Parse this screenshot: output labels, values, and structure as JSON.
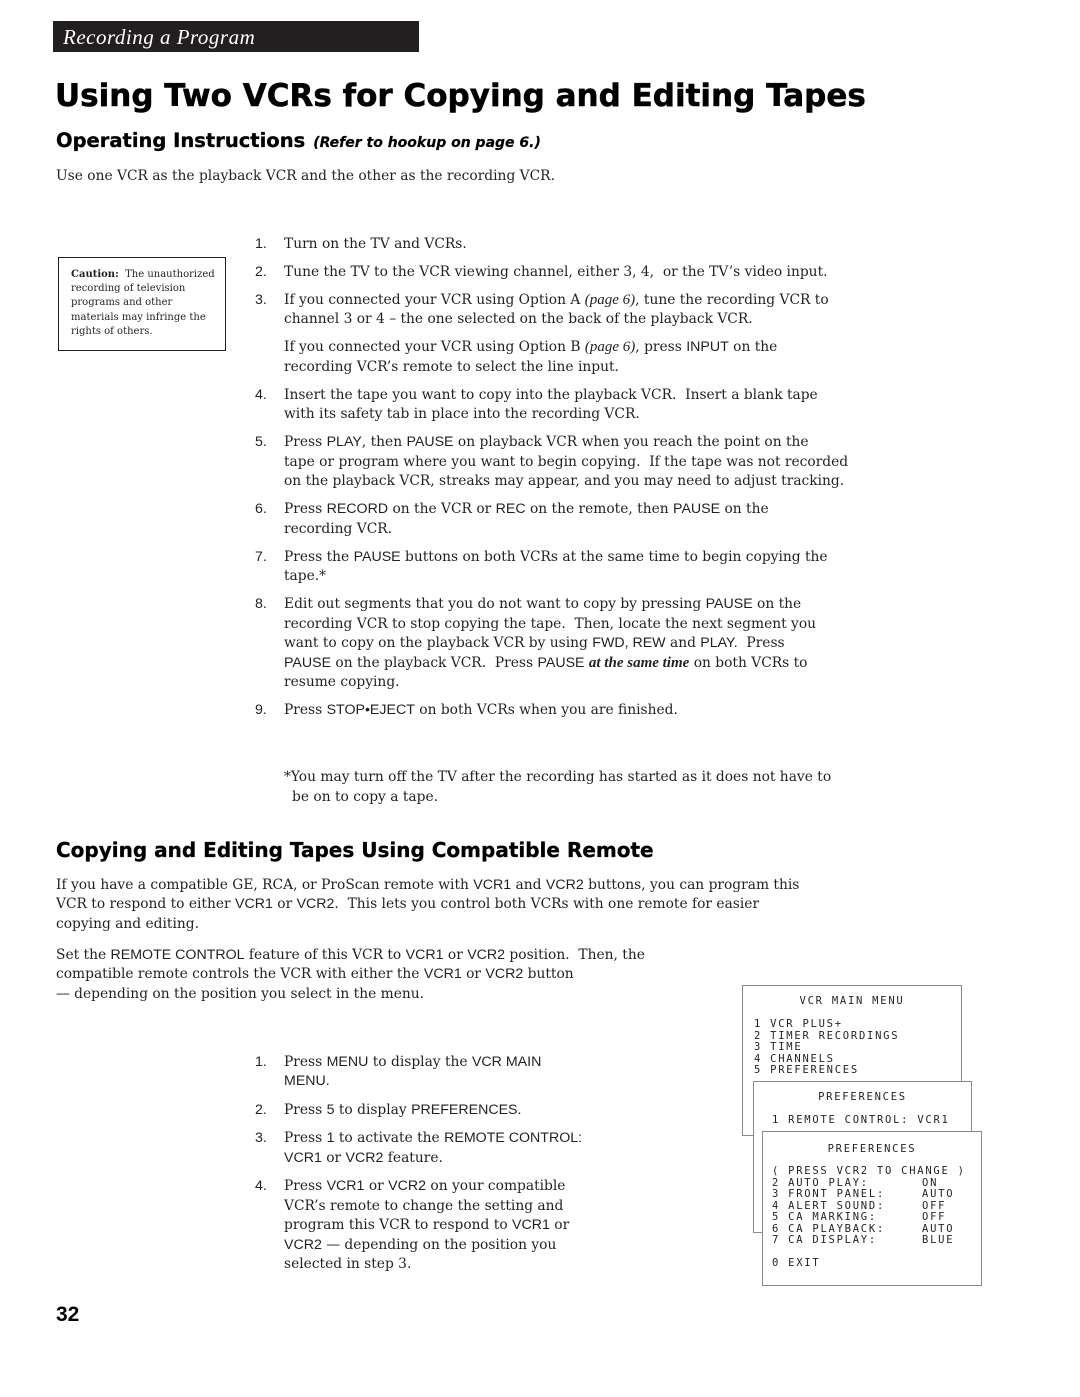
{
  "header": {
    "section_label": "Recording a Program"
  },
  "title": "Using Two VCRs for Copying and Editing Tapes",
  "section1": {
    "heading": "Operating Instructions",
    "heading_note": "(Refer to hookup on page 6.)",
    "intro": "Use one VCR as the playback VCR and the other as the recording VCR.",
    "caution": [
      {
        "type": "bold",
        "text": "Caution:"
      },
      {
        "type": "text",
        "text": "  The unauthorized\nrecording of television\nprograms and other\nmaterials may infringe the\nrights of others."
      }
    ],
    "steps": [
      {
        "num": "1.",
        "paras": [
          [
            {
              "type": "text",
              "text": "Turn on the TV and VCRs."
            }
          ]
        ]
      },
      {
        "num": "2.",
        "paras": [
          [
            {
              "type": "text",
              "text": "Tune the TV to the VCR viewing channel, either 3, 4,  or the TV’s video input."
            }
          ]
        ]
      },
      {
        "num": "3.",
        "paras": [
          [
            {
              "type": "text",
              "text": "If you connected your VCR using Option A "
            },
            {
              "type": "ref",
              "text": "(page 6)"
            },
            {
              "type": "text",
              "text": ", tune the recording VCR to\nchannel 3 or 4 – the one selected on the back of the playback VCR."
            }
          ],
          [
            {
              "type": "text",
              "text": "If you connected your VCR using Option B "
            },
            {
              "type": "ref",
              "text": "(page 6)"
            },
            {
              "type": "text",
              "text": ", press "
            },
            {
              "type": "key",
              "text": "INPUT"
            },
            {
              "type": "text",
              "text": " on the\nrecording VCR’s remote to select the line input."
            }
          ]
        ]
      },
      {
        "num": "4.",
        "paras": [
          [
            {
              "type": "text",
              "text": "Insert the tape you want to copy into the playback VCR.  Insert a blank tape\nwith its safety tab in place into the recording VCR."
            }
          ]
        ]
      },
      {
        "num": "5.",
        "paras": [
          [
            {
              "type": "text",
              "text": "Press "
            },
            {
              "type": "key",
              "text": "PLAY"
            },
            {
              "type": "text",
              "text": ", then "
            },
            {
              "type": "key",
              "text": "PAUSE"
            },
            {
              "type": "text",
              "text": " on playback VCR when you reach the point on the\ntape or program where you want to begin copying.  If the tape was not recorded\non the playback VCR, streaks may appear, and you may need to adjust tracking."
            }
          ]
        ]
      },
      {
        "num": "6.",
        "paras": [
          [
            {
              "type": "text",
              "text": "Press "
            },
            {
              "type": "key",
              "text": "RECORD"
            },
            {
              "type": "text",
              "text": " on the VCR or "
            },
            {
              "type": "key",
              "text": "REC"
            },
            {
              "type": "text",
              "text": " on the remote, then "
            },
            {
              "type": "key",
              "text": "PAUSE"
            },
            {
              "type": "text",
              "text": " on the\nrecording VCR."
            }
          ]
        ]
      },
      {
        "num": "7.",
        "paras": [
          [
            {
              "type": "text",
              "text": "Press the "
            },
            {
              "type": "key",
              "text": "PAUSE"
            },
            {
              "type": "text",
              "text": " buttons on both VCRs at the same time to begin copying the\ntape.*"
            }
          ]
        ]
      },
      {
        "num": "8.",
        "paras": [
          [
            {
              "type": "text",
              "text": "Edit out segments that you do not want to copy by pressing "
            },
            {
              "type": "key",
              "text": "PAUSE"
            },
            {
              "type": "text",
              "text": " on the\nrecording VCR to stop copying the tape.  Then, locate the next segment you\nwant to copy on the playback VCR by using "
            },
            {
              "type": "key",
              "text": "FWD, REW"
            },
            {
              "type": "text",
              "text": " and "
            },
            {
              "type": "key",
              "text": "PLAY."
            },
            {
              "type": "text",
              "text": "  Press\n"
            },
            {
              "type": "key",
              "text": "PAUSE"
            },
            {
              "type": "text",
              "text": " on the playback VCR.  Press "
            },
            {
              "type": "key",
              "text": "PAUSE"
            },
            {
              "type": "text",
              "text": " "
            },
            {
              "type": "em",
              "text": "at the same time"
            },
            {
              "type": "text",
              "text": " on both VCRs to\nresume copying."
            }
          ]
        ]
      },
      {
        "num": "9.",
        "paras": [
          [
            {
              "type": "text",
              "text": "Press "
            },
            {
              "type": "key",
              "text": "STOP•EJECT"
            },
            {
              "type": "text",
              "text": " on both VCRs when you are finished."
            }
          ]
        ]
      }
    ],
    "footnote": "*You may turn off the TV after the recording has started as it does not have to\nbe on to copy a tape."
  },
  "section2": {
    "heading": "Copying and Editing Tapes Using Compatible Remote",
    "paragraphs": [
      [
        {
          "type": "text",
          "text": "If you have a compatible GE, RCA, or ProScan remote with "
        },
        {
          "type": "key",
          "text": "VCR1"
        },
        {
          "type": "text",
          "text": " and "
        },
        {
          "type": "key",
          "text": "VCR2"
        },
        {
          "type": "text",
          "text": " buttons, you can program this\nVCR to respond to either "
        },
        {
          "type": "key",
          "text": "VCR1"
        },
        {
          "type": "text",
          "text": " or "
        },
        {
          "type": "key",
          "text": "VCR2"
        },
        {
          "type": "text",
          "text": ".  This lets you control both VCRs with one remote for easier\ncopying and editing."
        }
      ],
      [
        {
          "type": "text",
          "text": "Set the "
        },
        {
          "type": "key",
          "text": "REMOTE CONTROL"
        },
        {
          "type": "text",
          "text": " feature of this VCR to "
        },
        {
          "type": "key",
          "text": "VCR1"
        },
        {
          "type": "text",
          "text": " or "
        },
        {
          "type": "key",
          "text": "VCR2"
        },
        {
          "type": "text",
          "text": " position.  Then, the\ncompatible remote controls the VCR with either the "
        },
        {
          "type": "key",
          "text": "VCR1"
        },
        {
          "type": "text",
          "text": " or "
        },
        {
          "type": "key",
          "text": "VCR2"
        },
        {
          "type": "text",
          "text": " button\n— depending on the position you select in the menu."
        }
      ]
    ],
    "steps": [
      {
        "num": "1.",
        "paras": [
          [
            {
              "type": "text",
              "text": "Press "
            },
            {
              "type": "key",
              "text": "MENU"
            },
            {
              "type": "text",
              "text": " to display the "
            },
            {
              "type": "key",
              "text": "VCR MAIN\nMENU."
            }
          ]
        ]
      },
      {
        "num": "2.",
        "paras": [
          [
            {
              "type": "text",
              "text": "Press "
            },
            {
              "type": "key",
              "text": "5"
            },
            {
              "type": "text",
              "text": " to display "
            },
            {
              "type": "key",
              "text": "PREFERENCES."
            }
          ]
        ]
      },
      {
        "num": "3.",
        "paras": [
          [
            {
              "type": "text",
              "text": "Press "
            },
            {
              "type": "key",
              "text": "1"
            },
            {
              "type": "text",
              "text": " to activate the "
            },
            {
              "type": "key",
              "text": "REMOTE CONTROL:\nVCR1"
            },
            {
              "type": "text",
              "text": " or "
            },
            {
              "type": "key",
              "text": "VCR2"
            },
            {
              "type": "text",
              "text": " feature."
            }
          ]
        ]
      },
      {
        "num": "4.",
        "paras": [
          [
            {
              "type": "text",
              "text": "Press "
            },
            {
              "type": "key",
              "text": "VCR1"
            },
            {
              "type": "text",
              "text": " or "
            },
            {
              "type": "key",
              "text": "VCR2"
            },
            {
              "type": "text",
              "text": " on your compatible\nVCR’s remote to change the setting and\nprogram this VCR to respond to "
            },
            {
              "type": "key",
              "text": "VCR1"
            },
            {
              "type": "text",
              "text": " or\n"
            },
            {
              "type": "key",
              "text": "VCR2"
            },
            {
              "type": "text",
              "text": " — depending on the position you\nselected in step 3."
            }
          ]
        ]
      }
    ]
  },
  "menus": {
    "main": {
      "title": "VCR MAIN MENU",
      "items": [
        {
          "num": "1",
          "label": "VCR PLUS+"
        },
        {
          "num": "2",
          "label": "TIMER RECORDINGS"
        },
        {
          "num": "3",
          "label": "TIME"
        },
        {
          "num": "4",
          "label": "CHANNELS"
        },
        {
          "num": "5",
          "label": "PREFERENCES"
        }
      ]
    },
    "preferences_1": {
      "title": "PREFERENCES",
      "items": [
        {
          "num": "1",
          "label": "REMOTE CONTROL:",
          "value": "VCR1"
        }
      ]
    },
    "preferences_2": {
      "title": "PREFERENCES",
      "hint": "( PRESS VCR2 TO CHANGE )",
      "items": [
        {
          "num": "2",
          "label": "AUTO PLAY:",
          "value": "ON"
        },
        {
          "num": "3",
          "label": "FRONT PANEL:",
          "value": "AUTO"
        },
        {
          "num": "4",
          "label": "ALERT SOUND:",
          "value": "OFF"
        },
        {
          "num": "5",
          "label": "CA MARKING:",
          "value": "OFF"
        },
        {
          "num": "6",
          "label": "CA PLAYBACK:",
          "value": "AUTO"
        },
        {
          "num": "7",
          "label": "CA DISPLAY:",
          "value": "BLUE"
        }
      ],
      "exit": {
        "num": "0",
        "label": "EXIT"
      }
    }
  },
  "page_number": "32"
}
